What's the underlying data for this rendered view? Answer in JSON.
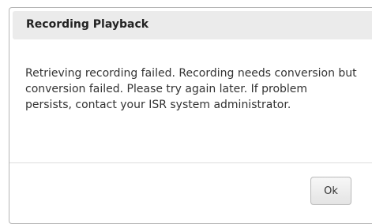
{
  "dialog": {
    "title": "Recording Playback",
    "message": "Retrieving recording failed. Recording needs conversion but conversion failed. Please try again later. If problem persists, contact your ISR system administrator.",
    "ok_label": "Ok"
  }
}
